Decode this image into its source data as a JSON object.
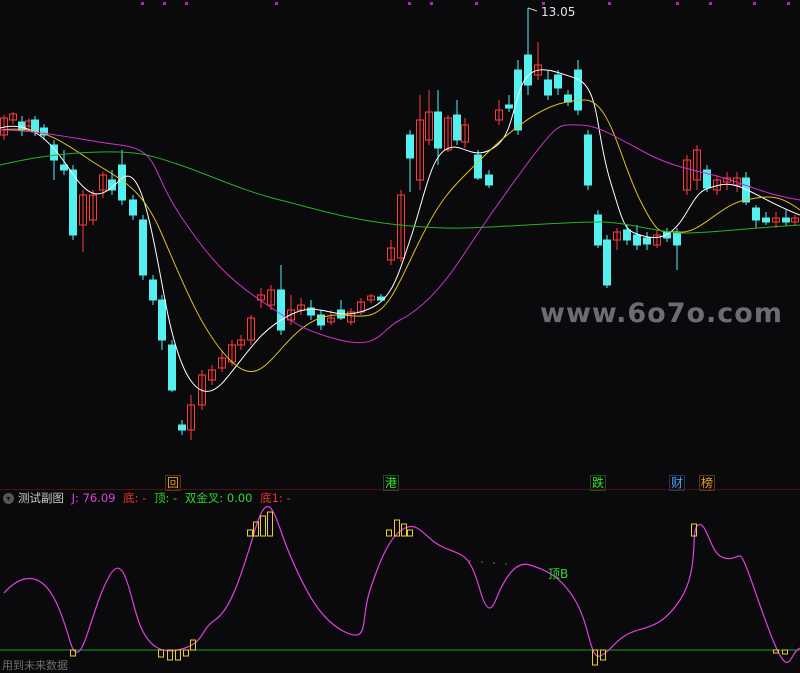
{
  "chart_data": [
    {
      "type": "candlestick",
      "annotation": "13.05",
      "moving_average_colors": [
        "#ffffff",
        "#e0c020",
        "#d030d0",
        "#28b028"
      ],
      "up_color": "#ff3b3b",
      "down_color": "#54f0f0"
    },
    {
      "type": "line",
      "series_label": "J",
      "line_color": "#e040e0",
      "bar_color": "#e8d030",
      "baseline_color": "#20a020",
      "annotation": "顶B"
    }
  ],
  "markers": [
    {
      "label": "回",
      "color": "#e8a020"
    },
    {
      "label": "港",
      "color": "#33e633"
    },
    {
      "label": "跌",
      "color": "#33e633"
    },
    {
      "label": "财",
      "color": "#50a0ff"
    },
    {
      "label": "榜",
      "color": "#e8a020"
    }
  ],
  "indicator": {
    "name": "测试副图",
    "j_label": "J: 76.09",
    "di_label": "底: -",
    "ding_label": "顶: -",
    "golden_cross_label": "双金叉: 0.00",
    "di1_label": "底1: -"
  },
  "watermark": "www.6o7o.com",
  "footer_text": "用到未来数据"
}
